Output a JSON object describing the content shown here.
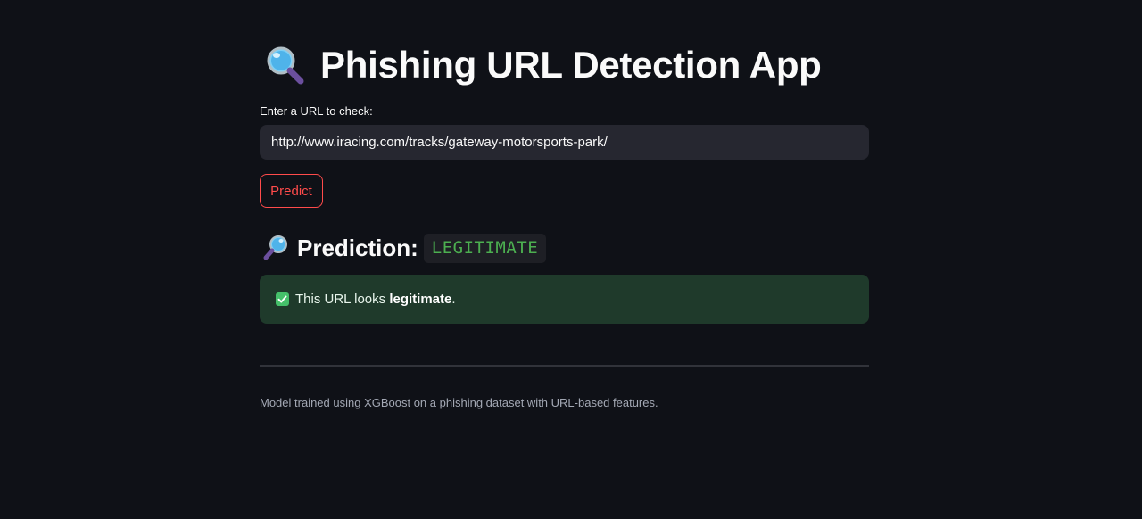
{
  "header": {
    "icon": "magnifying-glass-icon",
    "title": "Phishing URL Detection App"
  },
  "form": {
    "input_label": "Enter a URL to check:",
    "url_value": "http://www.iracing.com/tracks/gateway-motorsports-park/",
    "predict_label": "Predict"
  },
  "result": {
    "icon": "magnifying-glass-icon",
    "label": "Prediction:",
    "value": "LEGITIMATE",
    "message_prefix": "This URL looks ",
    "message_bold": "legitimate",
    "message_suffix": ".",
    "status_color": "#4caf50"
  },
  "footer": {
    "note": "Model trained using XGBoost on a phishing dataset with URL-based features."
  },
  "colors": {
    "background": "#0f1117",
    "accent": "#ff4b4b",
    "success_bg": "#1f3a2b"
  }
}
